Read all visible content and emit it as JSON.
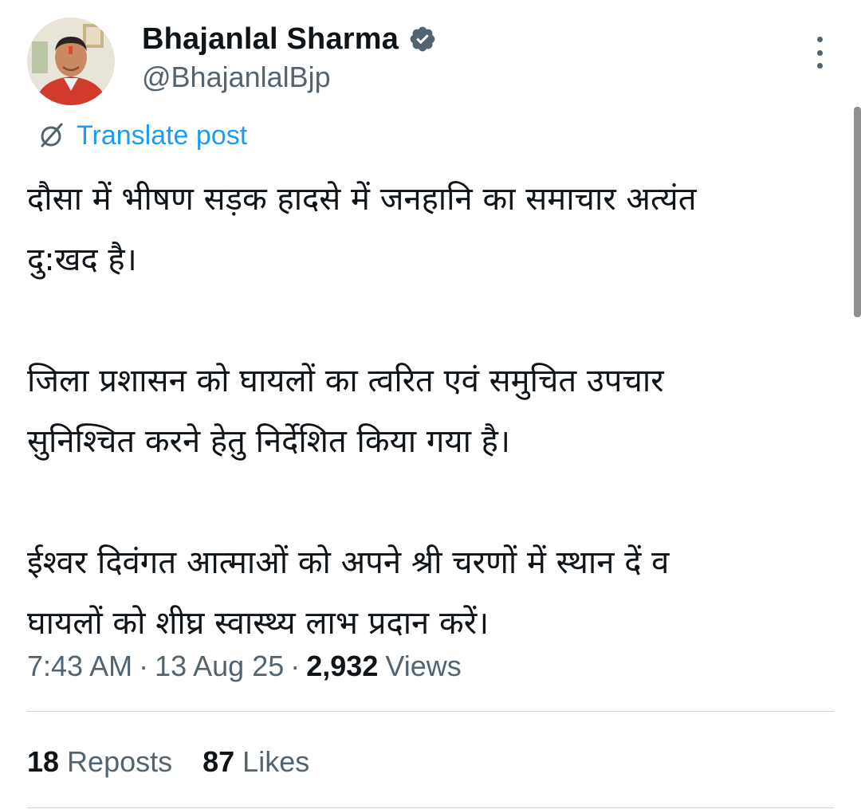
{
  "author": {
    "display_name": "Bhajanlal Sharma",
    "handle": "@BhajanlalBjp",
    "verified": true,
    "verified_color": "#536471"
  },
  "translate": {
    "label": "Translate post",
    "icon": "translate-icon",
    "color": "#1d9bf0"
  },
  "post": {
    "paragraphs": [
      "दौसा में भीषण सड़क हादसे में जनहानि का समाचार अत्यंत\nदु:खद है।",
      "जिला प्रशासन को घायलों का त्वरित एवं समुचित उपचार\nसुनिश्चित करने हेतु निर्देशित किया गया है।",
      "ईश्वर दिवंगत आत्माओं को अपने श्री चरणों में स्थान दें व\nघायलों को शीघ्र स्वास्थ्य लाभ प्रदान करें।"
    ]
  },
  "meta": {
    "time": "7:43 AM",
    "separator": "·",
    "date": "13 Aug 25",
    "views_count": "2,932",
    "views_label": "Views"
  },
  "stats": {
    "reposts_count": "18",
    "reposts_label": "Reposts",
    "likes_count": "87",
    "likes_label": "Likes"
  },
  "colors": {
    "text_primary": "#0f1419",
    "text_secondary": "#536471",
    "accent": "#1d9bf0",
    "divider": "#cfd9de"
  }
}
